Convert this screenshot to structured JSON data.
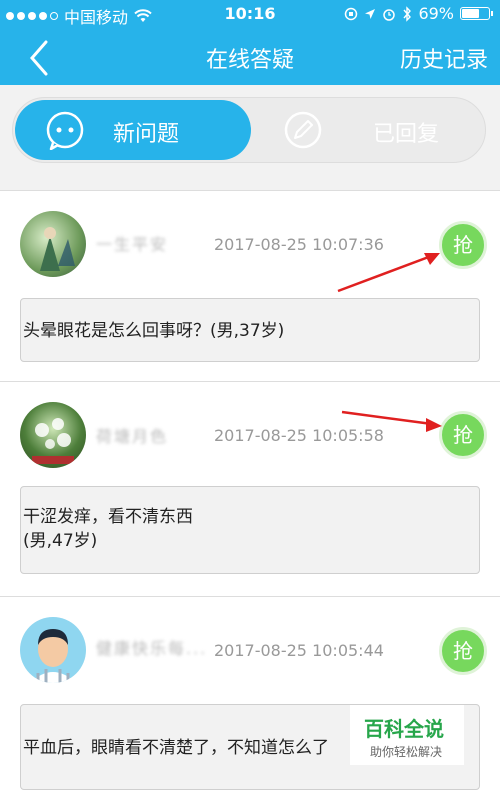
{
  "status": {
    "carrier": "中国移动",
    "time": "10:16",
    "battery": "69%",
    "battery_level": 0.69
  },
  "header": {
    "title": "在线答疑",
    "history": "历史记录"
  },
  "tabs": [
    {
      "label": "新问题",
      "active": true
    },
    {
      "label": "已回复",
      "active": false
    }
  ],
  "questions": [
    {
      "user": "一生平安",
      "time": "2017-08-25 10:07:36",
      "grab": "抢",
      "text": "头晕眼花是怎么回事呀？(男,37岁)"
    },
    {
      "user": "荷塘月色",
      "time": "2017-08-25 10:05:58",
      "grab": "抢",
      "text_line1": "干涩发痒，看不清东西",
      "text_line2": "(男,47岁)"
    },
    {
      "user": "健康快乐每...",
      "time": "2017-08-25 10:05:44",
      "grab": "抢",
      "text": "平血后，眼睛看不清楚了，不知道怎么了"
    }
  ],
  "watermark": {
    "title": "百科全说",
    "subtitle": "助你轻松解决"
  },
  "colors": {
    "brand": "#27b3ea",
    "grab": "#77d85d",
    "arrow": "#e02020"
  }
}
